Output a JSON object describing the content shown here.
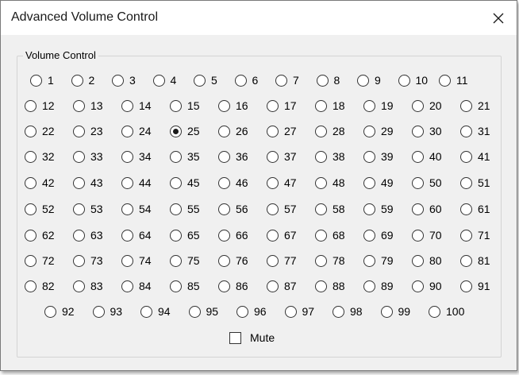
{
  "window": {
    "title": "Advanced Volume Control",
    "close_icon": "close-icon"
  },
  "group": {
    "label": "Volume Control"
  },
  "volume": {
    "options": [
      "1",
      "2",
      "3",
      "4",
      "5",
      "6",
      "7",
      "8",
      "9",
      "10",
      "11",
      "12",
      "13",
      "14",
      "15",
      "16",
      "17",
      "18",
      "19",
      "20",
      "21",
      "22",
      "23",
      "24",
      "25",
      "26",
      "27",
      "28",
      "29",
      "30",
      "31",
      "32",
      "33",
      "34",
      "35",
      "36",
      "37",
      "38",
      "39",
      "40",
      "41",
      "42",
      "43",
      "44",
      "45",
      "46",
      "47",
      "48",
      "49",
      "50",
      "51",
      "52",
      "53",
      "54",
      "55",
      "56",
      "57",
      "58",
      "59",
      "60",
      "61",
      "62",
      "63",
      "64",
      "65",
      "66",
      "67",
      "68",
      "69",
      "70",
      "71",
      "72",
      "73",
      "74",
      "75",
      "76",
      "77",
      "78",
      "79",
      "80",
      "81",
      "82",
      "83",
      "84",
      "85",
      "86",
      "87",
      "88",
      "89",
      "90",
      "91",
      "92",
      "93",
      "94",
      "95",
      "96",
      "97",
      "98",
      "99",
      "100"
    ],
    "selected": "25"
  },
  "mute": {
    "label": "Mute",
    "checked": false
  }
}
